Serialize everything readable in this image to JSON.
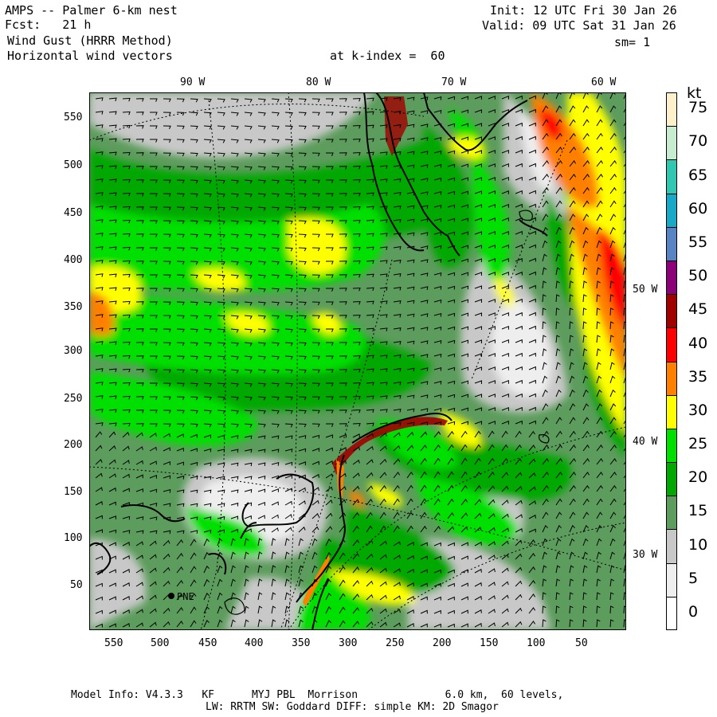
{
  "header": {
    "title": "AMPS -- Palmer 6-km nest",
    "forecast": "Fcst:   21 h",
    "field1": " Wind Gust (HRRR Method)",
    "field2": " Horizontal wind vectors",
    "level": "at k-index =  60",
    "init": "Init: 12 UTC Fri 30 Jan 26",
    "valid": "Valid: 09 UTC Sat 31 Jan 26",
    "smoothing": "sm= 1"
  },
  "axes": {
    "top_lon": [
      "90 W",
      "80 W",
      "70 W",
      "60 W"
    ],
    "right_lon": [
      "50 W",
      "40 W",
      "30 W"
    ],
    "y_ticks": [
      "550",
      "500",
      "450",
      "400",
      "350",
      "300",
      "250",
      "200",
      "150",
      "100",
      "50"
    ],
    "x_ticks": [
      "550",
      "500",
      "450",
      "400",
      "350",
      "300",
      "250",
      "200",
      "150",
      "100",
      "50"
    ]
  },
  "station": {
    "label": "PNE"
  },
  "colorbar": {
    "unit": "kt",
    "labels": [
      "75",
      "70",
      "65",
      "60",
      "55",
      "50",
      "45",
      "40",
      "35",
      "30",
      "25",
      "20",
      "15",
      "10",
      "5",
      "0"
    ],
    "colors": [
      "#fff0cc",
      "#c8ecd0",
      "#30c8b0",
      "#18a8c8",
      "#5884c4",
      "#8c0078",
      "#a00000",
      "#ff0000",
      "#ff8000",
      "#ffff00",
      "#00e000",
      "#00a800",
      "#5c9c5c",
      "#c8c8c8",
      "#eeeeee",
      "#ffffff"
    ]
  },
  "footer": {
    "line1": "Model Info: V4.3.3   KF      MYJ PBL  Morrison              6.0 km,  60 levels,",
    "line2": "LW: RRTM SW: Goddard DIFF: simple KM: 2D Smagor"
  }
}
